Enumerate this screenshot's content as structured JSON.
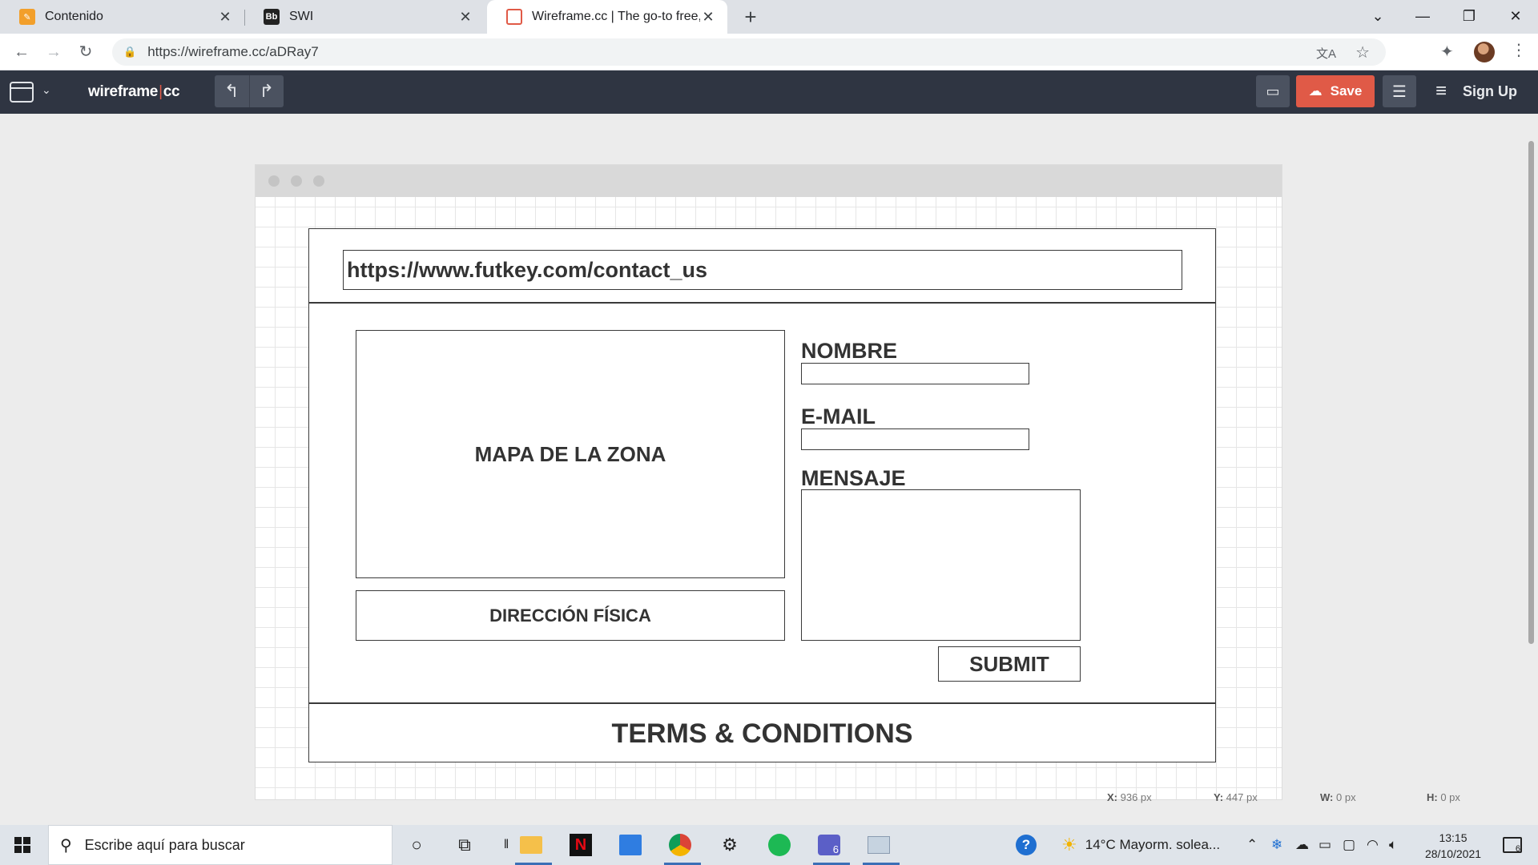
{
  "browser": {
    "tabs": [
      {
        "title": "Contenido",
        "icon": "pencil-note-icon",
        "color": "#f29f2b"
      },
      {
        "title": "SWI",
        "icon": "blackboard-icon",
        "color": "#222222"
      },
      {
        "title": "Wireframe.cc | The go-to free, on",
        "icon": "wireframe-icon",
        "color": "#e05a47"
      }
    ],
    "active_tab": 2,
    "url": "https://wireframe.cc/aDRay7"
  },
  "app": {
    "logo_left": "wireframe",
    "logo_sep": "|",
    "logo_right": "cc",
    "save_label": "Save",
    "signup_label": "Sign Up",
    "accent": "#e05a47",
    "header_bg": "#2f3542"
  },
  "wireframe": {
    "url_bar": "https://www.futkey.com/contact_us",
    "map_label": "MAPA DE LA ZONA",
    "address_label": "DIRECCIÓN FÍSICA",
    "name_label": "NOMBRE",
    "email_label": "E-MAIL",
    "message_label": "MENSAJE",
    "submit_label": "SUBMIT",
    "footer_label": "TERMS & CONDITIONS"
  },
  "status": {
    "x_label": "X:",
    "x_value": "936 px",
    "y_label": "Y:",
    "y_value": "447 px",
    "w_label": "W:",
    "w_value": "0 px",
    "h_label": "H:",
    "h_value": "0 px"
  },
  "taskbar": {
    "search_placeholder": "Escribe aquí para buscar",
    "weather": "14°C  Mayorm. solea...",
    "time": "13:15",
    "date": "28/10/2021",
    "teams_badge": "6",
    "notif_count": "6"
  }
}
